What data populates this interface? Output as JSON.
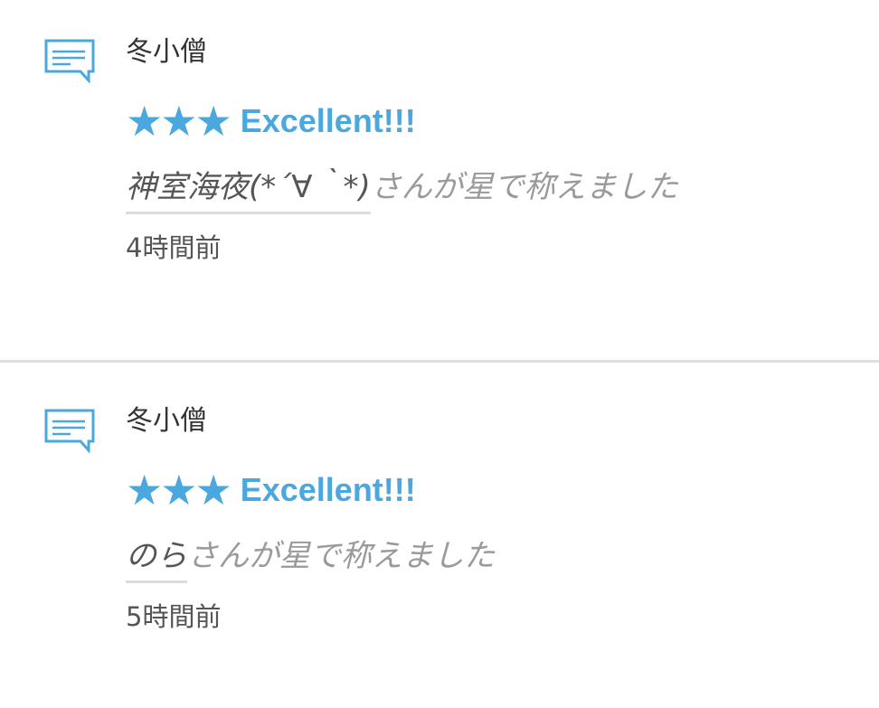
{
  "accent_color": "#4aa8de",
  "notifications": [
    {
      "icon": "speech-bubble-icon",
      "username": "冬小僧",
      "stars": "★★★",
      "rating_label": "Excellent!!!",
      "actor": "神室海夜(*´∀｀*)",
      "message": "さんが星で称えました",
      "timestamp": "4時間前"
    },
    {
      "icon": "speech-bubble-icon",
      "username": "冬小僧",
      "stars": "★★★",
      "rating_label": "Excellent!!!",
      "actor": "のら",
      "message": "さんが星で称えました",
      "timestamp": "5時間前"
    }
  ]
}
